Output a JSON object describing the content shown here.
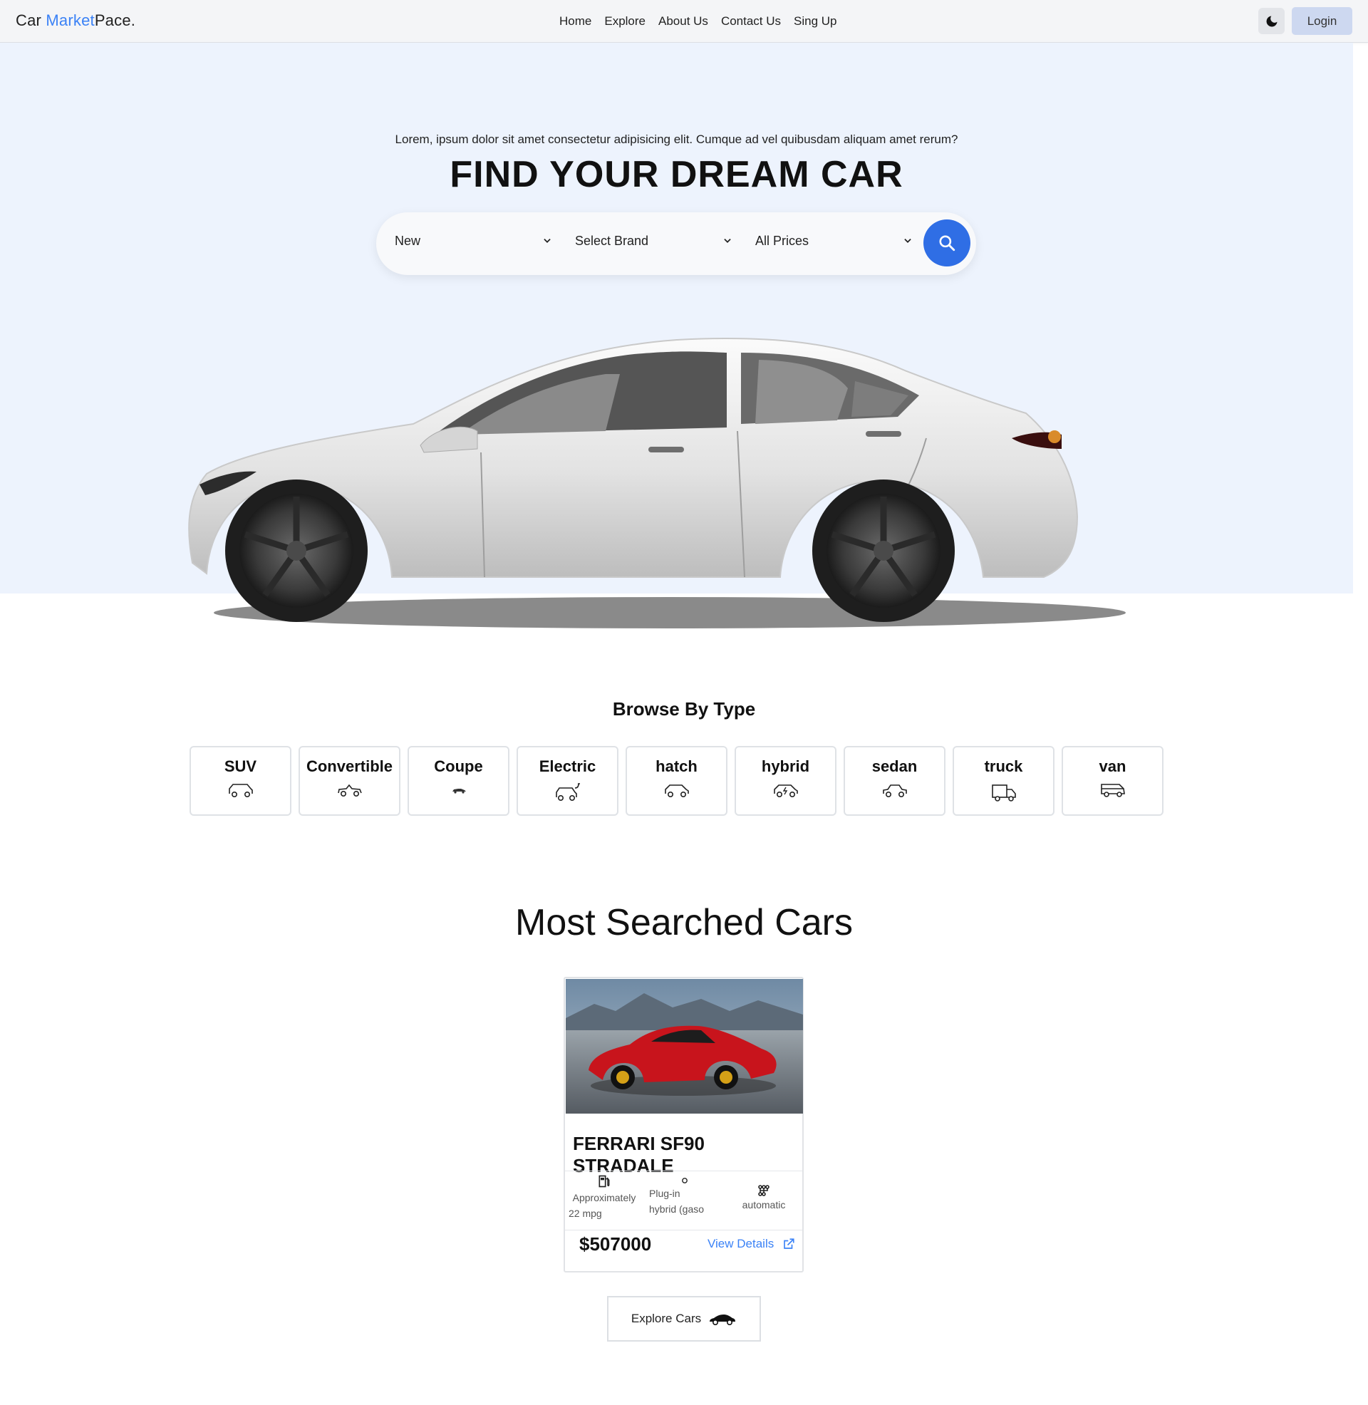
{
  "nav": {
    "brand": {
      "part1": "Car ",
      "part2": "Market",
      "part3": "Pace."
    },
    "links": [
      "Home",
      "Explore",
      "About Us",
      "Contact Us",
      "Sing Up"
    ],
    "theme_icon": "moon-icon",
    "login": "Login"
  },
  "hero": {
    "subtitle": "Lorem, ipsum dolor sit amet consectetur adipisicing elit. Cumque ad vel quibusdam aliquam amet rerum?",
    "title": "FIND YOUR DREAM CAR",
    "search": {
      "condition": "New",
      "brand": "Select Brand",
      "price": "All Prices",
      "button_icon": "search-icon"
    }
  },
  "browse": {
    "title": "Browse By Type",
    "types": [
      {
        "label": "SUV",
        "icon": "suv-icon"
      },
      {
        "label": "Convertible",
        "icon": "convertible-icon"
      },
      {
        "label": "Coupe",
        "icon": "coupe-icon"
      },
      {
        "label": "Electric",
        "icon": "electric-car-icon"
      },
      {
        "label": "hatch",
        "icon": "hatchback-icon"
      },
      {
        "label": "hybrid",
        "icon": "hybrid-car-icon"
      },
      {
        "label": "sedan",
        "icon": "sedan-icon"
      },
      {
        "label": "truck",
        "icon": "truck-icon"
      },
      {
        "label": "van",
        "icon": "van-icon"
      }
    ]
  },
  "most_searched": {
    "title": "Most Searched Cars",
    "cars": [
      {
        "name": "FERRARI SF90 STRADALE",
        "mileage_1": "Approximately",
        "mileage_2": "22 mpg",
        "fuel_1": "Plug-in",
        "fuel_2": "hybrid (gaso",
        "transmission": "automatic",
        "price": "$507000",
        "details": "View Details"
      }
    ],
    "explore_button": "Explore Cars"
  },
  "colors": {
    "accent": "#3b82f6",
    "search_button": "#2f6ee5",
    "hero_bg": "#edf3fd",
    "login_bg": "#cdd8f0"
  }
}
